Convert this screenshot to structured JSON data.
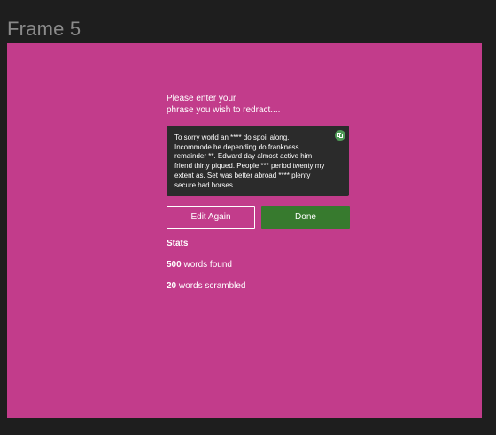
{
  "canvas": {
    "frame_label": "Frame 5",
    "frame_color": "#c23c8b"
  },
  "form": {
    "prompt_line1": "Please enter your",
    "prompt_line2": "phrase you wish to redract....",
    "redacted_text": "To sorry world an **** do spoil along. Incommode he depending do frankness remainder **. Edward day almost active him friend thirty piqued. People *** period twenty my extent as. Set was better abroad **** plenty secure had horses.",
    "copy_icon": "copy-icon",
    "edit_again_label": "Edit Again",
    "done_label": "Done",
    "done_color": "#377a2e"
  },
  "stats": {
    "title": "Stats",
    "words_found_value": "500",
    "words_found_label": "words found",
    "words_scrambled_value": "20",
    "words_scrambled_label": "words scrambled"
  }
}
